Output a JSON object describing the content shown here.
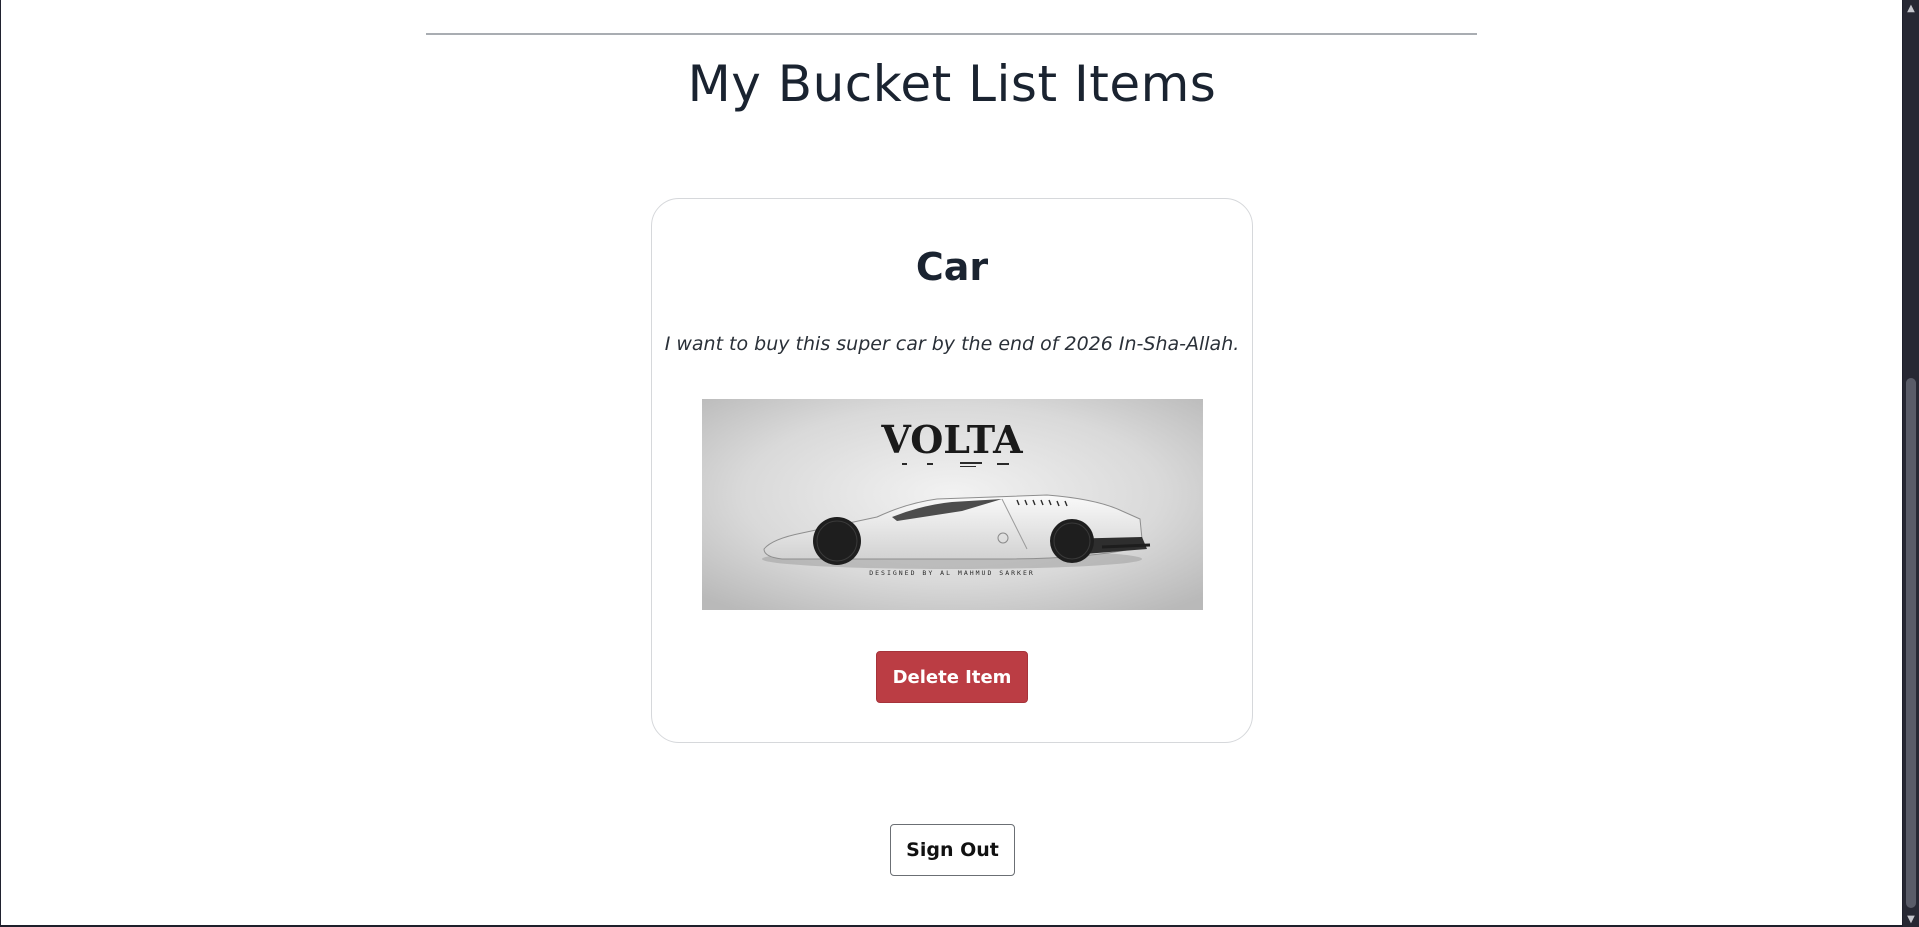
{
  "page": {
    "title": "My Bucket List Items"
  },
  "items": [
    {
      "title": "Car",
      "description": "I want to buy this super car by the end of 2026 In-Sha-Allah.",
      "image": {
        "brand_text": "VOLTA",
        "caption": "DESIGNED BY AL MAHMUD SARKER"
      },
      "delete_label": "Delete Item"
    }
  ],
  "actions": {
    "sign_out_label": "Sign Out"
  },
  "scrollbar": {
    "up_icon": "chevron-up-icon",
    "down_icon": "chevron-down-icon"
  },
  "colors": {
    "danger": "#bb3d44",
    "text": "#1a2330",
    "scrollbar_bg": "#272833"
  }
}
